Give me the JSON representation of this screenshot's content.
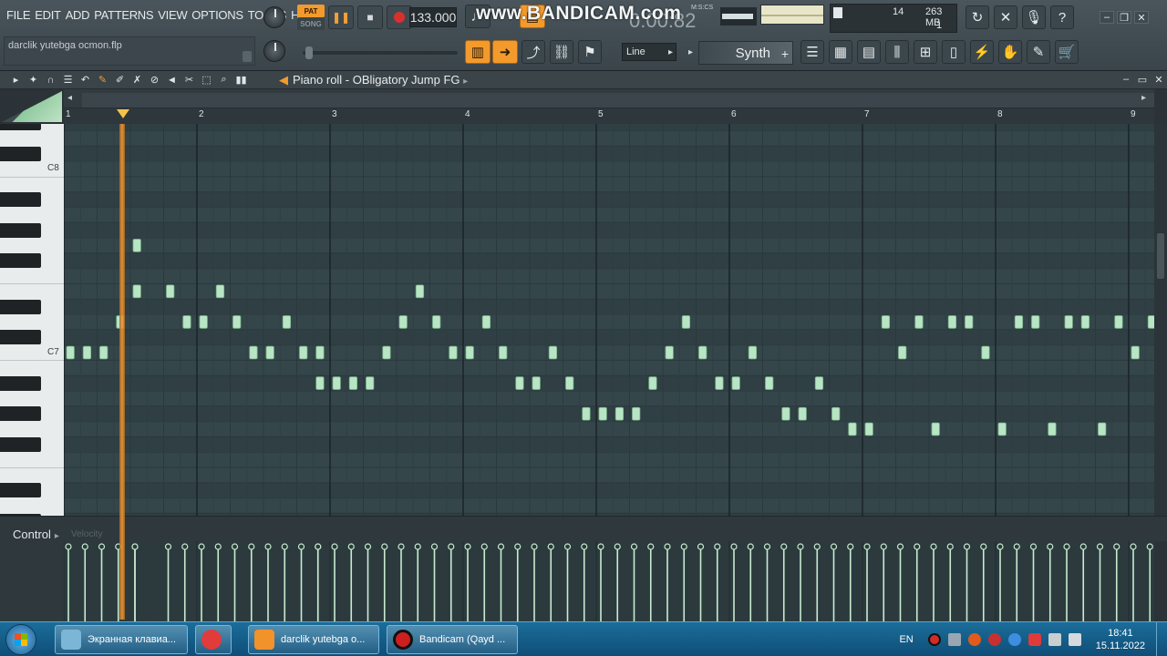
{
  "menu": [
    "FILE",
    "EDIT",
    "ADD",
    "PATTERNS",
    "VIEW",
    "OPTIONS",
    "TOOLS",
    "HELP"
  ],
  "project": {
    "filename": "darclik yutebga ocmon.flp"
  },
  "transport": {
    "pat_label": "PAT",
    "song_label": "SONG",
    "tempo": "133.000",
    "time": "0:00:82",
    "time_unit": "M:S:CS"
  },
  "watermark": "www.BANDICAM.com",
  "cpu_monitor": {
    "cpu": "14",
    "memory": "263 MB",
    "polyphony": "1"
  },
  "tools": {
    "snap_mode": "Line",
    "channel": "Synth",
    "channel_add": "+"
  },
  "piano_roll": {
    "title": "Piano roll - OBligatory Jump FG",
    "bars": [
      "1",
      "2",
      "3",
      "4",
      "5",
      "6",
      "7",
      "8",
      "9"
    ],
    "octave_labels": [
      "C8",
      "C7"
    ]
  },
  "notes": [
    {
      "step": 0,
      "key": 0
    },
    {
      "step": 1,
      "key": 0
    },
    {
      "step": 2,
      "key": 0
    },
    {
      "step": 3,
      "key": 2
    },
    {
      "step": 4,
      "key": 7
    },
    {
      "step": 4,
      "key": 4
    },
    {
      "step": 6,
      "key": 4
    },
    {
      "step": 7,
      "key": 2
    },
    {
      "step": 8,
      "key": 2
    },
    {
      "step": 9,
      "key": 4
    },
    {
      "step": 10,
      "key": 2
    },
    {
      "step": 11,
      "key": 0
    },
    {
      "step": 12,
      "key": 0
    },
    {
      "step": 13,
      "key": 2
    },
    {
      "step": 14,
      "key": 0
    },
    {
      "step": 15,
      "key": 0
    },
    {
      "step": 15,
      "key": -2
    },
    {
      "step": 16,
      "key": -2
    },
    {
      "step": 17,
      "key": -2
    },
    {
      "step": 18,
      "key": -2
    },
    {
      "step": 19,
      "key": 0
    },
    {
      "step": 20,
      "key": 2
    },
    {
      "step": 21,
      "key": 4
    },
    {
      "step": 22,
      "key": 2
    },
    {
      "step": 23,
      "key": 0
    },
    {
      "step": 24,
      "key": 0
    },
    {
      "step": 25,
      "key": 2
    },
    {
      "step": 26,
      "key": 0
    },
    {
      "step": 27,
      "key": -2
    },
    {
      "step": 28,
      "key": -2
    },
    {
      "step": 29,
      "key": 0
    },
    {
      "step": 30,
      "key": -2
    },
    {
      "step": 31,
      "key": -4
    },
    {
      "step": 32,
      "key": -4
    },
    {
      "step": 33,
      "key": -4
    },
    {
      "step": 34,
      "key": -4
    },
    {
      "step": 35,
      "key": -2
    },
    {
      "step": 36,
      "key": 0
    },
    {
      "step": 37,
      "key": 2
    },
    {
      "step": 38,
      "key": 0
    },
    {
      "step": 39,
      "key": -2
    },
    {
      "step": 40,
      "key": -2
    },
    {
      "step": 41,
      "key": 0
    },
    {
      "step": 42,
      "key": -2
    },
    {
      "step": 43,
      "key": -4
    },
    {
      "step": 44,
      "key": -4
    },
    {
      "step": 45,
      "key": -2
    },
    {
      "step": 46,
      "key": -4
    },
    {
      "step": 47,
      "key": -5
    },
    {
      "step": 48,
      "key": -5
    },
    {
      "step": 49,
      "key": 2
    },
    {
      "step": 50,
      "key": 0
    },
    {
      "step": 51,
      "key": 2
    },
    {
      "step": 52,
      "key": -5
    },
    {
      "step": 53,
      "key": 2
    },
    {
      "step": 54,
      "key": 2
    },
    {
      "step": 55,
      "key": 0
    },
    {
      "step": 56,
      "key": -5
    },
    {
      "step": 57,
      "key": 2
    },
    {
      "step": 58,
      "key": 2
    },
    {
      "step": 59,
      "key": -5
    },
    {
      "step": 60,
      "key": 2
    },
    {
      "step": 61,
      "key": 2
    },
    {
      "step": 62,
      "key": -5
    },
    {
      "step": 63,
      "key": 2
    },
    {
      "step": 64,
      "key": 0
    },
    {
      "step": 65,
      "key": 2
    },
    {
      "step": 66,
      "key": 12
    },
    {
      "step": 67,
      "key": 12
    }
  ],
  "control": {
    "label": "Control",
    "param": "Velocity"
  },
  "taskbar": {
    "items": [
      "Экранная клавиа...",
      "darclik yutebga o...",
      "Bandicam (Qayd ..."
    ],
    "lang": "EN",
    "time": "18:41",
    "date": "15.11.2022"
  },
  "colors": {
    "accent": "#f29a2c",
    "note": "#b8e6c4",
    "grid_bg": "#34464a",
    "playhead": "#f09a3a"
  }
}
